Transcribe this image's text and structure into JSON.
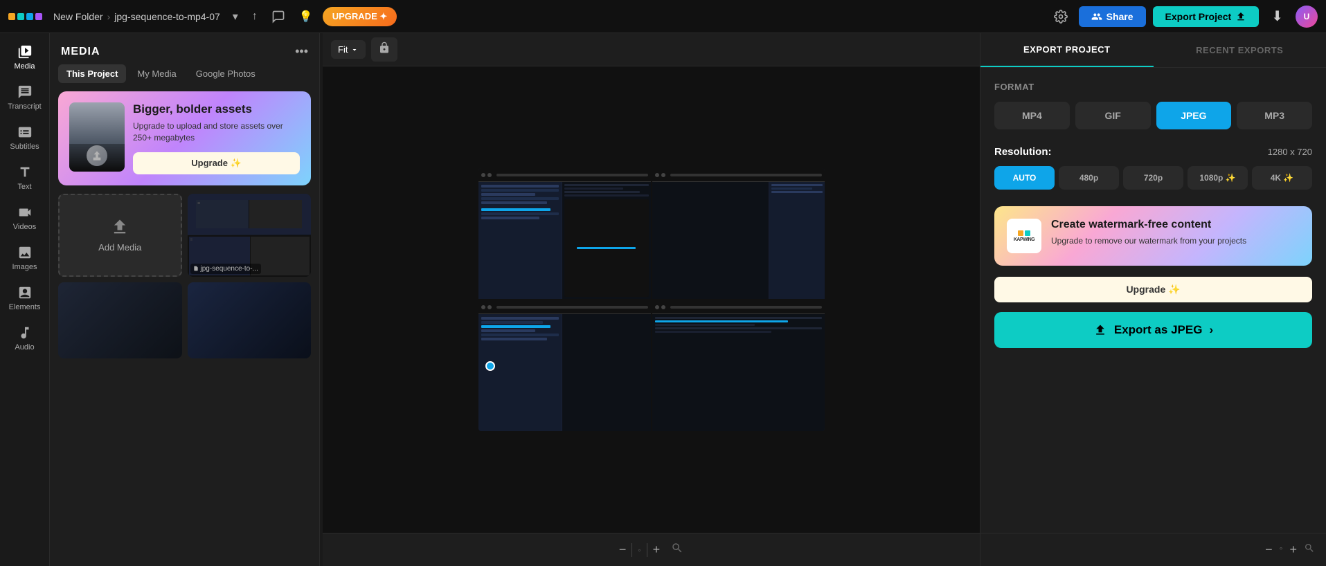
{
  "topbar": {
    "folder": "New Folder",
    "chevron": "›",
    "project_name": "jpg-sequence-to-mp4-07",
    "upgrade_label": "UPGRADE ✦",
    "share_label": "Share",
    "export_project_label": "Export Project",
    "settings_icon": "⚙",
    "comment_icon": "💬",
    "bulb_icon": "💡",
    "download_icon": "⬇",
    "share_icon": "👤"
  },
  "sidebar": {
    "items": [
      {
        "id": "media",
        "label": "Media",
        "icon": "media"
      },
      {
        "id": "transcript",
        "label": "Transcript",
        "icon": "transcript"
      },
      {
        "id": "subtitles",
        "label": "Subtitles",
        "icon": "subtitles"
      },
      {
        "id": "text",
        "label": "Text",
        "icon": "text"
      },
      {
        "id": "videos",
        "label": "Videos",
        "icon": "videos"
      },
      {
        "id": "images",
        "label": "Images",
        "icon": "images"
      },
      {
        "id": "elements",
        "label": "Elements",
        "icon": "elements"
      },
      {
        "id": "audio",
        "label": "Audio",
        "icon": "audio"
      }
    ]
  },
  "media_panel": {
    "title": "MEDIA",
    "tabs": [
      "This Project",
      "My Media",
      "Google Photos"
    ],
    "active_tab": "This Project",
    "upgrade_banner": {
      "title": "Bigger, bolder assets",
      "description": "Upgrade to upload and store assets over 250+ megabytes",
      "button_label": "Upgrade ✨"
    },
    "add_media_label": "Add Media",
    "media_file_label": "jpg-sequence-to-..."
  },
  "canvas": {
    "fit_label": "Fit",
    "zoom_hint": "fit"
  },
  "export_panel": {
    "tab_export": "EXPORT PROJECT",
    "tab_recent": "RECENT EXPORTS",
    "format_label": "Format",
    "formats": [
      "MP4",
      "GIF",
      "JPEG",
      "MP3"
    ],
    "active_format": "JPEG",
    "resolution_label": "Resolution:",
    "resolution_value": "1280 x 720",
    "resolutions": [
      "AUTO",
      "480p",
      "720p",
      "1080p ✨",
      "4K ✨"
    ],
    "active_resolution": "AUTO",
    "watermark_banner": {
      "title": "Create watermark-free content",
      "description": "Upgrade to remove our watermark from your projects",
      "button_label": "Upgrade ✨"
    },
    "export_button_label": "Export as JPEG",
    "export_icon": "↑",
    "chevron": "›"
  },
  "bottom_bar": {
    "zoom_out": "−",
    "zoom_value": "°",
    "zoom_in": "+",
    "search_icon": "⌕"
  }
}
